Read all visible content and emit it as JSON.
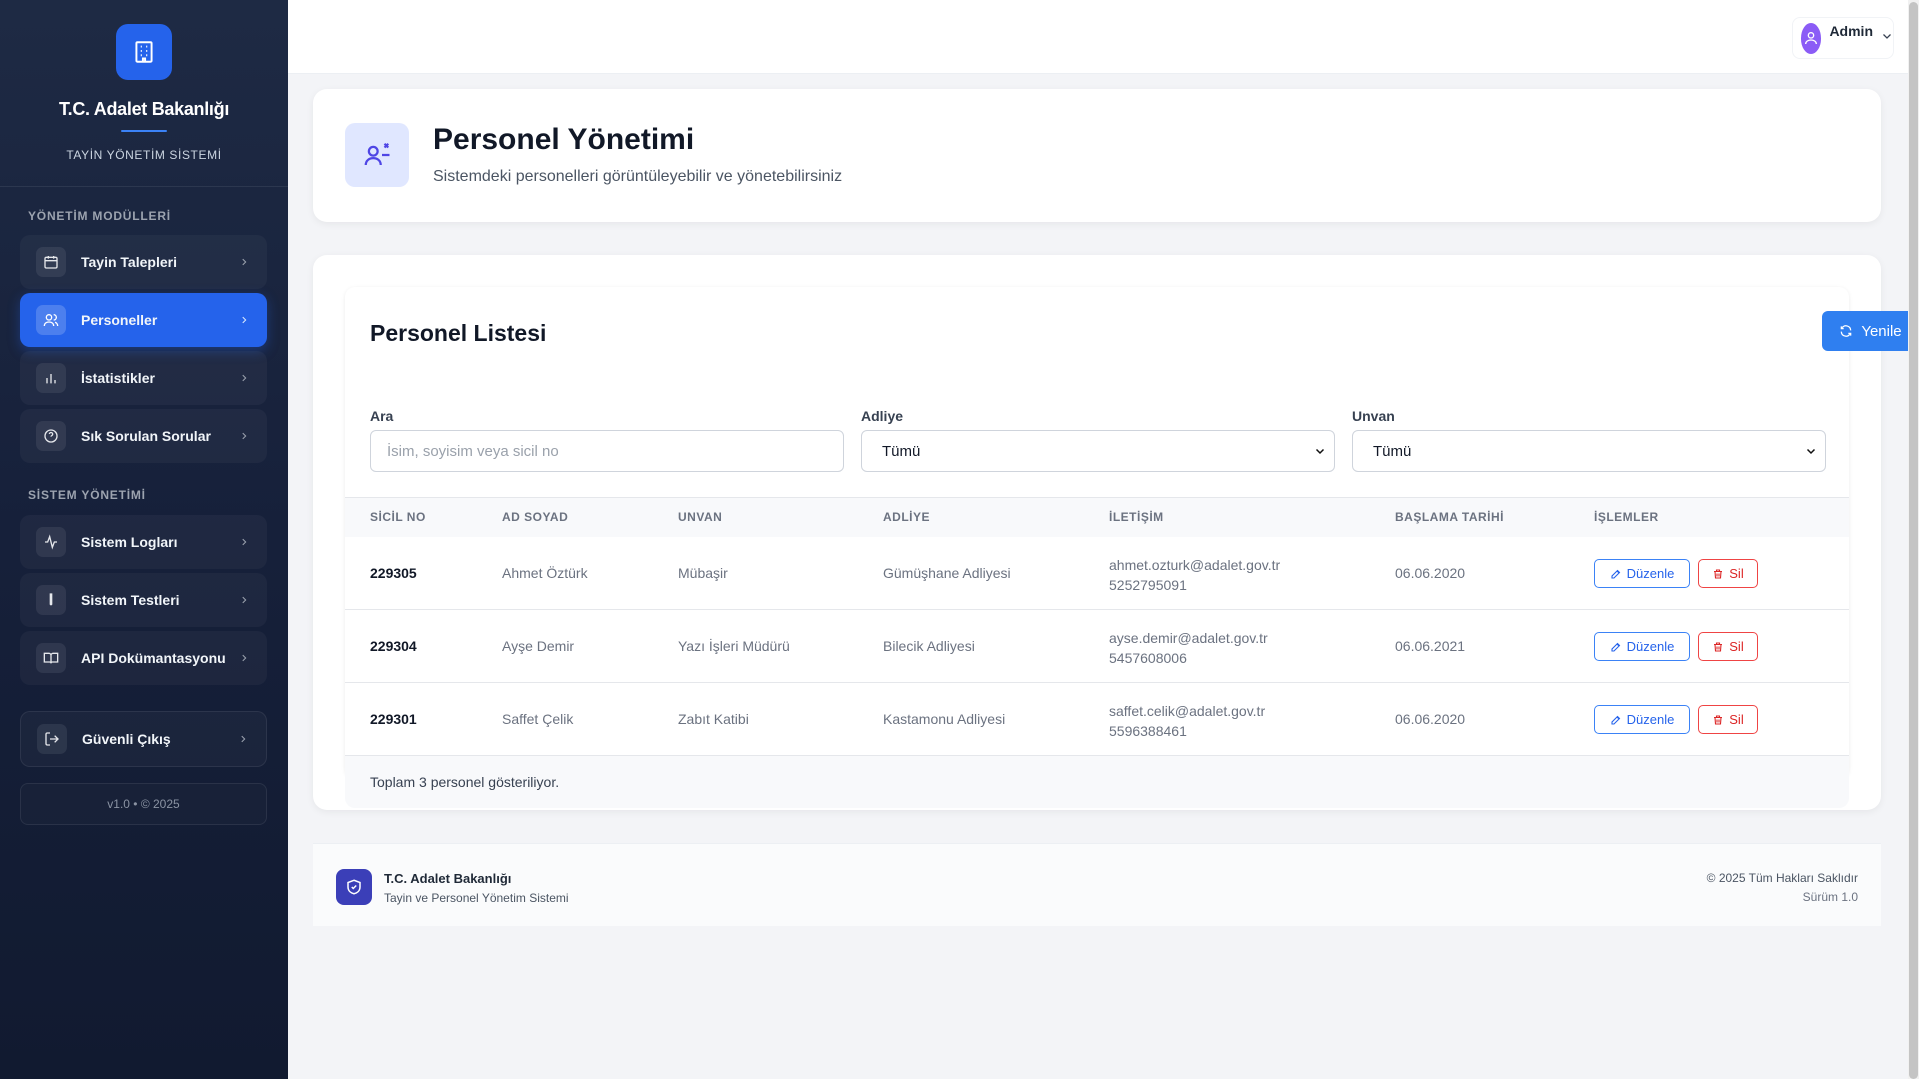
{
  "sidebar": {
    "brand_title": "T.C. Adalet Bakanlığı",
    "brand_subtitle": "TAYİN YÖNETİM SİSTEMİ",
    "section_management": "YÖNETİM MODÜLLERİ",
    "section_system": "SİSTEM YÖNETİMİ",
    "items": [
      {
        "label": "Tayin Talepleri",
        "icon": "calendar-icon",
        "active": false
      },
      {
        "label": "Personeller",
        "icon": "users-icon",
        "active": true
      },
      {
        "label": "İstatistikler",
        "icon": "bar-chart-icon",
        "active": false
      },
      {
        "label": "Sık Sorulan Sorular",
        "icon": "help-circle-icon",
        "active": false
      },
      {
        "label": "Sistem Logları",
        "icon": "activity-icon",
        "active": false
      },
      {
        "label": "Sistem Testleri",
        "icon": "test-tube-icon",
        "active": false
      },
      {
        "label": "API Dokümantasyonu",
        "icon": "book-icon",
        "active": false
      }
    ],
    "logout_label": "Güvenli Çıkış",
    "version_text": "v1.0 • © 2025"
  },
  "topbar": {
    "user_name": "Admin"
  },
  "header": {
    "title": "Personel Yönetimi",
    "subtitle": "Sistemdeki personelleri görüntüleyebilir ve yönetebilirsiniz"
  },
  "list": {
    "title": "Personel Listesi",
    "refresh_label": "Yenile",
    "filters": {
      "search_label": "Ara",
      "search_placeholder": "İsim, soyisim veya sicil no",
      "court_label": "Adliye",
      "court_value": "Tümü",
      "title_label": "Unvan",
      "title_value": "Tümü"
    },
    "columns": [
      "SİCİL NO",
      "AD SOYAD",
      "UNVAN",
      "ADLİYE",
      "İLETİŞİM",
      "BAŞLAMA TARİHİ",
      "İŞLEMLER"
    ],
    "rows": [
      {
        "sicil": "229305",
        "name": "Ahmet Öztürk",
        "title": "Mübaşir",
        "court": "Gümüşhane Adliyesi",
        "email": "ahmet.ozturk@adalet.gov.tr",
        "phone": "5252795091",
        "start": "06.06.2020"
      },
      {
        "sicil": "229304",
        "name": "Ayşe Demir",
        "title": "Yazı İşleri Müdürü",
        "court": "Bilecik Adliyesi",
        "email": "ayse.demir@adalet.gov.tr",
        "phone": "5457608006",
        "start": "06.06.2021"
      },
      {
        "sicil": "229301",
        "name": "Saffet Çelik",
        "title": "Zabıt Katibi",
        "court": "Kastamonu Adliyesi",
        "email": "saffet.celik@adalet.gov.tr",
        "phone": "5596388461",
        "start": "06.06.2020"
      }
    ],
    "edit_label": "Düzenle",
    "delete_label": "Sil",
    "summary": "Toplam 3 personel gösteriliyor."
  },
  "footer": {
    "title": "T.C. Adalet Bakanlığı",
    "subtitle": "Tayin ve Personel Yönetim Sistemi",
    "copyright": "© 2025 Tüm Hakları Saklıdır",
    "version": "Sürüm 1.0"
  },
  "colors": {
    "primary": "#2563eb",
    "sidebar_bg": "#1b2540",
    "danger": "#dc2626",
    "avatar": "#8b5cf6"
  }
}
